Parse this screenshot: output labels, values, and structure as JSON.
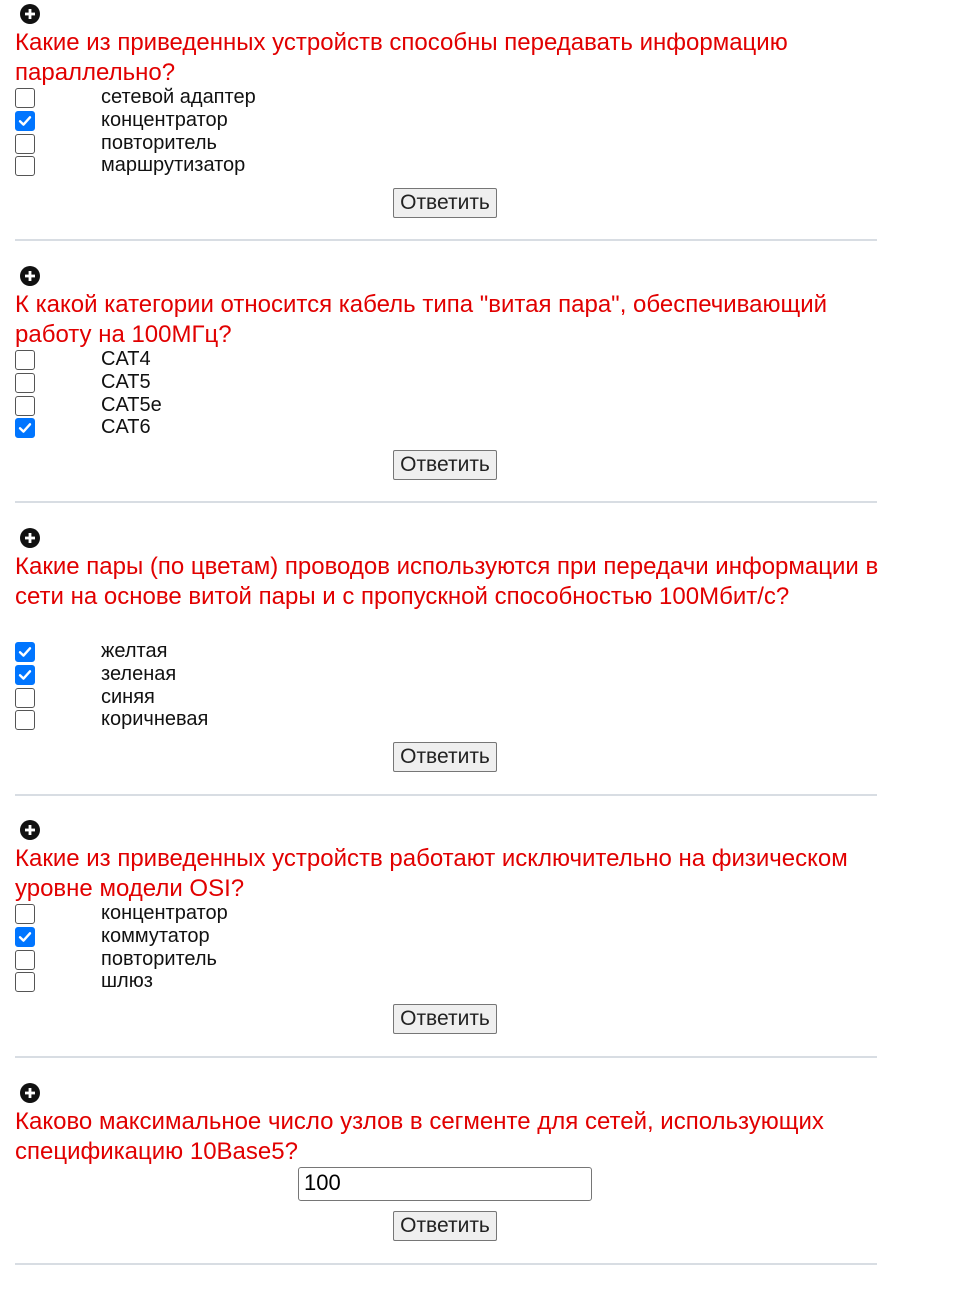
{
  "button_label": "Ответить",
  "questions": [
    {
      "text": "Какие из приведенных устройств способны передавать информацию параллельно?",
      "options": [
        {
          "label": "сетевой адаптер",
          "checked": false
        },
        {
          "label": "концентратор",
          "checked": true
        },
        {
          "label": "повторитель",
          "checked": false
        },
        {
          "label": "маршрутизатор",
          "checked": false
        }
      ]
    },
    {
      "text": "К какой категории относится кабель типа \"витая пара\", обеспечивающий работу на 100МГц?",
      "options": [
        {
          "label": "CAT4",
          "checked": false
        },
        {
          "label": "CAT5",
          "checked": false
        },
        {
          "label": "CAT5e",
          "checked": false
        },
        {
          "label": "CAT6",
          "checked": true
        }
      ]
    },
    {
      "text": "Какие пары (по цветам) проводов используются при передачи информации в сети на основе витой пары и с пропускной способностью 100Мбит/с?",
      "options": [
        {
          "label": "желтая",
          "checked": true
        },
        {
          "label": "зеленая",
          "checked": true
        },
        {
          "label": "синяя",
          "checked": false
        },
        {
          "label": "коричневая",
          "checked": false
        }
      ]
    },
    {
      "text": "Какие из приведенных устройств работают исключительно на физическом уровне модели OSI?",
      "options": [
        {
          "label": "концентратор",
          "checked": false
        },
        {
          "label": "коммутатор",
          "checked": true
        },
        {
          "label": "повторитель",
          "checked": false
        },
        {
          "label": "шлюз",
          "checked": false
        }
      ]
    },
    {
      "text": "Каково максимальное число узлов в сегменте для сетей, использующих спецификацию 10Base5?",
      "input_value": "100"
    }
  ],
  "colors": {
    "question_text": "#e10000",
    "checkbox_checked": "#0075ff"
  }
}
